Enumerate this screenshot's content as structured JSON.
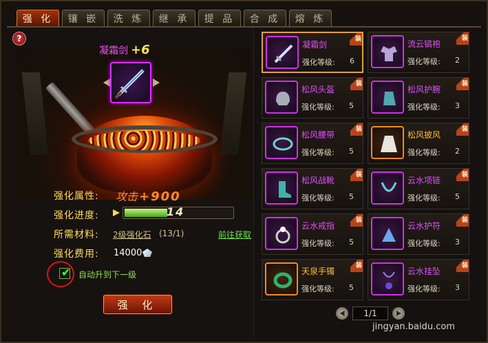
{
  "tabs": [
    "强 化",
    "镶 嵌",
    "洗 炼",
    "继 承",
    "提 品",
    "合 成",
    "熔 炼"
  ],
  "active_tab": 0,
  "help_label": "?",
  "item": {
    "name": "凝霜剑",
    "plus": "+6"
  },
  "stats": {
    "attr_label": "强化属性:",
    "attr_value_label": "攻击",
    "attr_value": "+900",
    "progress_label": "强化进度:",
    "progress_value": "14",
    "progress_fraction": 0.4,
    "material_label": "所需材料:",
    "material_link": "2级强化石",
    "material_count": "(13/1)",
    "fetch_link": "前往获取",
    "cost_label": "强化费用:",
    "cost_value": "14000",
    "auto_upgrade_label": "自动升到下一级",
    "auto_upgrade_checked": true
  },
  "enhance_button": "强 化",
  "equipment": [
    {
      "name": "凝霜剑",
      "level_label": "强化等级:",
      "level": "6",
      "color": "purple",
      "selected": true,
      "icon": "sword-icon"
    },
    {
      "name": "流云镐袍",
      "level_label": "强化等级:",
      "level": "2",
      "color": "purple",
      "selected": false,
      "icon": "robe-icon"
    },
    {
      "name": "松风头盔",
      "level_label": "强化等级:",
      "level": "5",
      "color": "purple",
      "selected": false,
      "icon": "helmet-icon"
    },
    {
      "name": "松风护腕",
      "level_label": "强化等级:",
      "level": "3",
      "color": "purple",
      "selected": false,
      "icon": "bracer-icon"
    },
    {
      "name": "松风腰带",
      "level_label": "强化等级:",
      "level": "5",
      "color": "purple",
      "selected": false,
      "icon": "belt-icon"
    },
    {
      "name": "松风披风",
      "level_label": "强化等级:",
      "level": "2",
      "color": "orange",
      "selected": false,
      "icon": "cape-icon"
    },
    {
      "name": "松风战靴",
      "level_label": "强化等级:",
      "level": "5",
      "color": "purple",
      "selected": false,
      "icon": "boots-icon"
    },
    {
      "name": "云水项链",
      "level_label": "强化等级:",
      "level": "5",
      "color": "purple",
      "selected": false,
      "icon": "necklace-icon"
    },
    {
      "name": "云水戒指",
      "level_label": "强化等级:",
      "level": "5",
      "color": "purple",
      "selected": false,
      "icon": "ring-icon"
    },
    {
      "name": "云水护符",
      "level_label": "强化等级:",
      "level": "3",
      "color": "purple",
      "selected": false,
      "icon": "amulet-icon"
    },
    {
      "name": "天泉手镯",
      "level_label": "强化等级:",
      "level": "5",
      "color": "orange",
      "selected": false,
      "icon": "bracelet-icon"
    },
    {
      "name": "云水挂坠",
      "level_label": "强化等级:",
      "level": "3",
      "color": "purple",
      "selected": false,
      "icon": "pendant-icon"
    }
  ],
  "equip_badge": "装",
  "pager": {
    "text": "1/1"
  },
  "watermark": "jingyan.baidu.com",
  "colors": {
    "purple": "#e24cff",
    "orange": "#ffb83a",
    "accent": "#ffd95a",
    "button": "#bf3a13"
  }
}
